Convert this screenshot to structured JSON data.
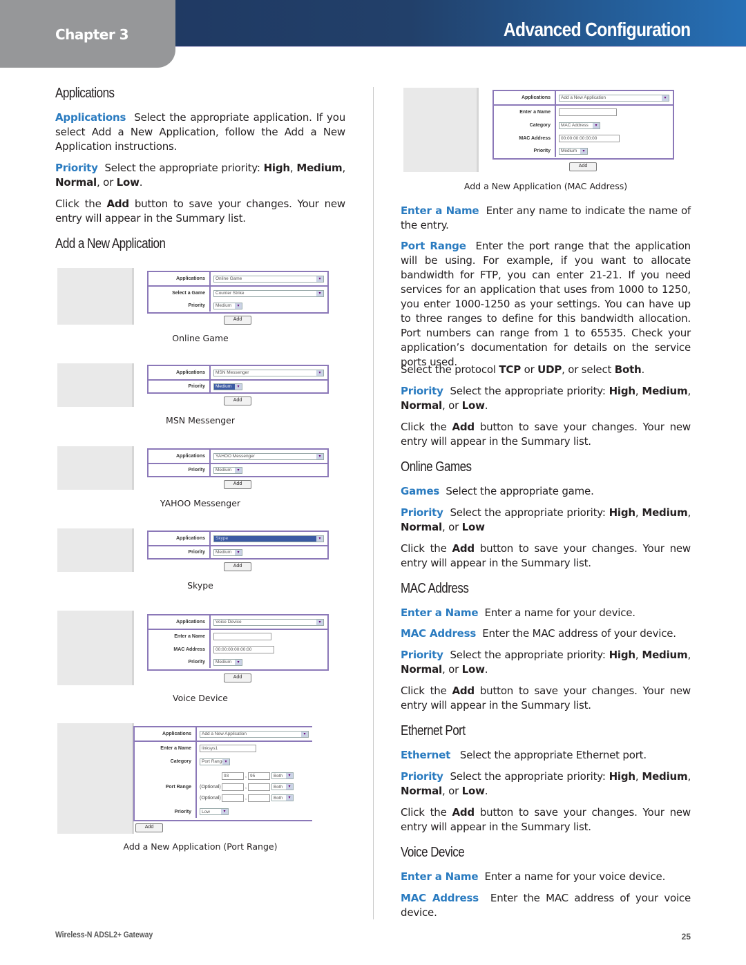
{
  "header": {
    "chapter": "Chapter 3",
    "title": "Advanced Configuration"
  },
  "left": {
    "applications_heading": "Applications",
    "applications_term": "Applications",
    "applications_text": "Select the appropriate application. If you select Add a New Application, follow the Add a New Application instructions.",
    "priority_term": "Priority",
    "priority_text_pre": "Select the appropriate priority: ",
    "high": "High",
    "medium": "Medium",
    "normal": "Normal",
    "or": ", or ",
    "low": "Low",
    "add_text_pre": "Click the ",
    "add_word": "Add",
    "add_text_post": " button to save your changes. Your new entry will appear in the Summary list.",
    "add_new_heading": "Add a New Application"
  },
  "figures": {
    "online_game": {
      "caption": "Online Game",
      "rows": [
        {
          "label": "Applications",
          "value": "Online Game"
        },
        {
          "label": "Select a Game",
          "value": "Counter Strike"
        },
        {
          "label": "Priority",
          "value": "Medium"
        }
      ],
      "add": "Add"
    },
    "msn": {
      "caption": "MSN Messenger",
      "rows": [
        {
          "label": "Applications",
          "value": "MSN Messenger"
        },
        {
          "label": "Priority",
          "value": "Medium"
        }
      ],
      "add": "Add"
    },
    "yahoo": {
      "caption": "YAHOO Messenger",
      "rows": [
        {
          "label": "Applications",
          "value": "YAHOO Messenger"
        },
        {
          "label": "Priority",
          "value": "Medium"
        }
      ],
      "add": "Add"
    },
    "skype": {
      "caption": "Skype",
      "rows": [
        {
          "label": "Applications",
          "value": "Skype"
        },
        {
          "label": "Priority",
          "value": "Medium"
        }
      ],
      "add": "Add"
    },
    "voice": {
      "caption": "Voice Device",
      "rows": [
        {
          "label": "Applications",
          "value": "Voice Device"
        },
        {
          "label": "Enter a Name",
          "value": ""
        },
        {
          "label": "MAC Address",
          "value": "00:00:00:00:00:00"
        },
        {
          "label": "Priority",
          "value": "Medium"
        }
      ],
      "add": "Add"
    },
    "port_range": {
      "caption": "Add a New Application (Port Range)",
      "rows": [
        {
          "label": "Applications",
          "value": "Add a New Application"
        },
        {
          "label": "Enter a Name",
          "value": "linksys1"
        },
        {
          "label": "Category",
          "value": "Port Range"
        },
        {
          "label": "Port Range",
          "value": ""
        },
        {
          "label": "Priority",
          "value": "Low"
        }
      ],
      "ranges": [
        {
          "prefix": "",
          "start": "93",
          "end": "95",
          "protocol": "Both"
        },
        {
          "prefix": "(Optional)",
          "start": "",
          "end": "",
          "protocol": "Both"
        },
        {
          "prefix": "(Optional)",
          "start": "",
          "end": "",
          "protocol": "Both"
        }
      ],
      "comma": ",",
      "add": "Add"
    },
    "mac": {
      "caption": "Add a New Application (MAC Address)",
      "rows": [
        {
          "label": "Applications",
          "value": "Add a New Application"
        },
        {
          "label": "Enter a Name",
          "value": ""
        },
        {
          "label": "Category",
          "value": "MAC Address"
        },
        {
          "label": "MAC Address",
          "value": "00:00:00:00:00:00"
        },
        {
          "label": "Priority",
          "value": "Medium"
        }
      ],
      "add": "Add"
    }
  },
  "right": {
    "enter_name_term": "Enter a Name",
    "enter_name_text": "Enter any name to indicate the name of the entry.",
    "port_range_term": "Port Range",
    "port_range_text": "Enter the port range that the application will be using. For example, if you want to allocate bandwidth for FTP, you can enter 21-21. If you need services for an application that uses from 1000 to 1250, you enter 1000-1250 as your settings. You can have up to three ranges to define for this bandwidth allocation. Port numbers can range from 1 to 65535. Check your application’s documentation for details on the service ports used.",
    "protocol_pre": "Select the protocol ",
    "tcp": "TCP",
    "or1": " or ",
    "udp": "UDP",
    "or_select": ", or select ",
    "both": "Both",
    "period": ".",
    "online_games_heading": "Online Games",
    "games_term": "Games",
    "games_text": "Select the appropriate game.",
    "mac_heading": "MAC Address",
    "mac_enter_name_text": "Enter a name for your device.",
    "mac_term": "MAC Address",
    "mac_text": "Enter the MAC address of your device.",
    "ethernet_heading": "Ethernet Port",
    "ethernet_term": "Ethernet",
    "ethernet_text": "Select the appropriate Ethernet port.",
    "voice_heading": "Voice Device",
    "voice_enter_name_text": "Enter a name for your voice device.",
    "voice_mac_text": "Enter the MAC address of your voice device."
  },
  "footer": {
    "product": "Wireless-N ADSL2+ Gateway",
    "page": "25"
  },
  "colors": {
    "accent": "#2a7bc0",
    "header_dark": "#1e355e",
    "header_light": "#2670b6",
    "chapter_tab": "#969799"
  }
}
